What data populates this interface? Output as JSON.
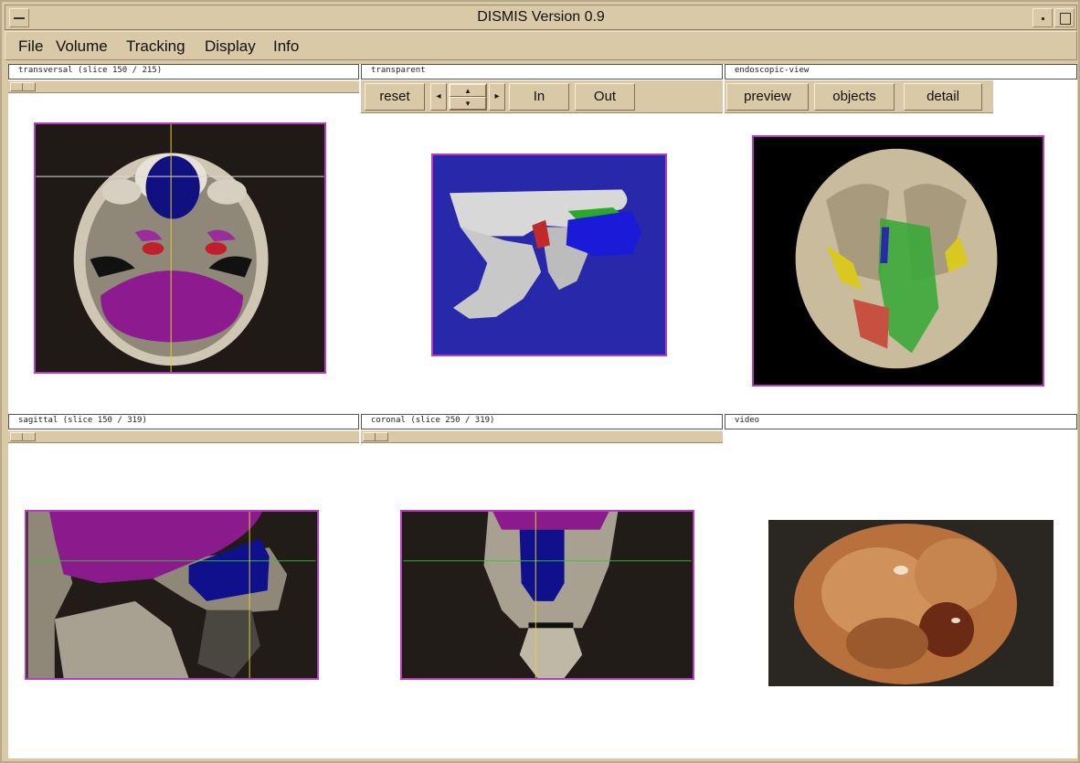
{
  "window": {
    "title": "DISMIS Version 0.9"
  },
  "menu": [
    {
      "label": "File"
    },
    {
      "label": "Volume"
    },
    {
      "label": "Tracking"
    },
    {
      "label": "Display"
    },
    {
      "label": "Info"
    }
  ],
  "panels": {
    "transversal": {
      "label": "transversal (slice 150 / 215)"
    },
    "transparent": {
      "label": "transparent"
    },
    "endoscopic": {
      "label": "endoscopic-view"
    },
    "sagittal": {
      "label": "sagittal (slice 150 / 319)"
    },
    "coronal": {
      "label": "coronal (slice 250 / 319)"
    },
    "video": {
      "label": "video"
    }
  },
  "toolbar_transparent": {
    "reset": "reset",
    "left": "◂",
    "up": "▴",
    "down": "▾",
    "right": "▸",
    "in": "In",
    "out": "Out"
  },
  "toolbar_endoscopic": {
    "preview": "preview",
    "objects": "objects",
    "detail": "detail"
  },
  "colors": {
    "chrome": "#d9c9a6",
    "view_border": "#b83cbf",
    "segment_blue": "#1a1a9e",
    "segment_purple": "#8a1a8a",
    "segment_red": "#c0202a",
    "segment_green": "#2a9a2a",
    "segment_yellow": "#d8c820"
  }
}
